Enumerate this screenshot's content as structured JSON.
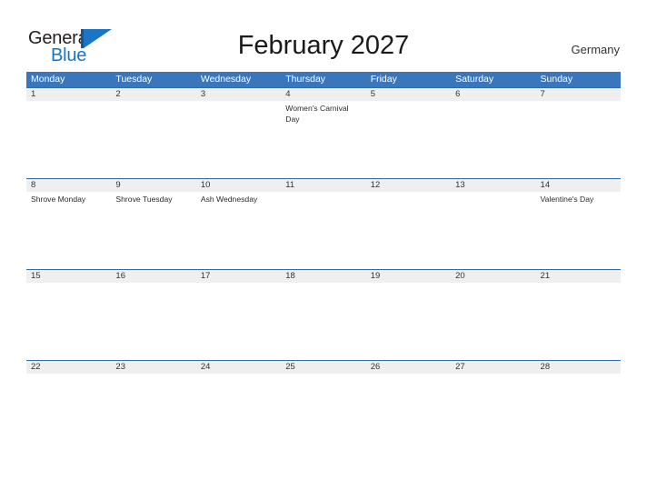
{
  "brand": {
    "name_part1": "General",
    "name_part2": "Blue",
    "flag_icon": "flag-triangle-icon"
  },
  "header": {
    "title": "February 2027",
    "country": "Germany"
  },
  "colors": {
    "header_blue": "#3a76bc",
    "rule_blue": "#2f6aab",
    "band_gray": "#efefef",
    "logo_blue": "#1a76c4",
    "text_dark": "#333333"
  },
  "calendar": {
    "weekdays": [
      "Monday",
      "Tuesday",
      "Wednesday",
      "Thursday",
      "Friday",
      "Saturday",
      "Sunday"
    ],
    "weeks": [
      [
        {
          "date": "1",
          "events": []
        },
        {
          "date": "2",
          "events": []
        },
        {
          "date": "3",
          "events": []
        },
        {
          "date": "4",
          "events": [
            "Women's Carnival Day"
          ]
        },
        {
          "date": "5",
          "events": []
        },
        {
          "date": "6",
          "events": []
        },
        {
          "date": "7",
          "events": []
        }
      ],
      [
        {
          "date": "8",
          "events": [
            "Shrove Monday"
          ]
        },
        {
          "date": "9",
          "events": [
            "Shrove Tuesday"
          ]
        },
        {
          "date": "10",
          "events": [
            "Ash Wednesday"
          ]
        },
        {
          "date": "11",
          "events": []
        },
        {
          "date": "12",
          "events": []
        },
        {
          "date": "13",
          "events": []
        },
        {
          "date": "14",
          "events": [
            "Valentine's Day"
          ]
        }
      ],
      [
        {
          "date": "15",
          "events": []
        },
        {
          "date": "16",
          "events": []
        },
        {
          "date": "17",
          "events": []
        },
        {
          "date": "18",
          "events": []
        },
        {
          "date": "19",
          "events": []
        },
        {
          "date": "20",
          "events": []
        },
        {
          "date": "21",
          "events": []
        }
      ],
      [
        {
          "date": "22",
          "events": []
        },
        {
          "date": "23",
          "events": []
        },
        {
          "date": "24",
          "events": []
        },
        {
          "date": "25",
          "events": []
        },
        {
          "date": "26",
          "events": []
        },
        {
          "date": "27",
          "events": []
        },
        {
          "date": "28",
          "events": []
        }
      ]
    ]
  }
}
